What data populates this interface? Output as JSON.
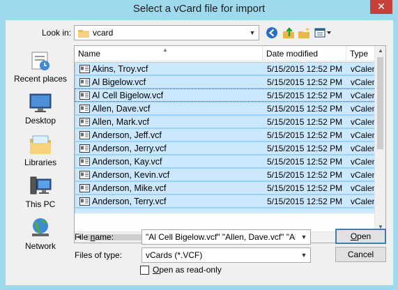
{
  "window": {
    "title": "Select a vCard file for import",
    "close_glyph": "✕"
  },
  "toolbar": {
    "look_in_label": "Look in:",
    "look_in_value": "vcard",
    "icons": [
      "back-icon",
      "up-folder-icon",
      "new-folder-icon",
      "view-menu-icon"
    ]
  },
  "places": [
    {
      "label": "Recent places",
      "icon": "recent-places-icon"
    },
    {
      "label": "Desktop",
      "icon": "desktop-icon"
    },
    {
      "label": "Libraries",
      "icon": "libraries-icon"
    },
    {
      "label": "This PC",
      "icon": "this-pc-icon"
    },
    {
      "label": "Network",
      "icon": "network-icon"
    }
  ],
  "file_list": {
    "columns": [
      "Name",
      "Date modified",
      "Type"
    ],
    "rows": [
      {
        "name": "Akins, Troy.vcf",
        "date": "5/15/2015 12:52 PM",
        "type": "vCalen"
      },
      {
        "name": "Al Bigelow.vcf",
        "date": "5/15/2015 12:52 PM",
        "type": "vCalen"
      },
      {
        "name": "Al Cell Bigelow.vcf",
        "date": "5/15/2015 12:52 PM",
        "type": "vCalen"
      },
      {
        "name": "Allen, Dave.vcf",
        "date": "5/15/2015 12:52 PM",
        "type": "vCalen"
      },
      {
        "name": "Allen, Mark.vcf",
        "date": "5/15/2015 12:52 PM",
        "type": "vCalen"
      },
      {
        "name": "Anderson, Jeff.vcf",
        "date": "5/15/2015 12:52 PM",
        "type": "vCalen"
      },
      {
        "name": "Anderson, Jerry.vcf",
        "date": "5/15/2015 12:52 PM",
        "type": "vCalen"
      },
      {
        "name": "Anderson, Kay.vcf",
        "date": "5/15/2015 12:52 PM",
        "type": "vCalen"
      },
      {
        "name": "Anderson, Kevin.vcf",
        "date": "5/15/2015 12:52 PM",
        "type": "vCalen"
      },
      {
        "name": "Anderson, Mike.vcf",
        "date": "5/15/2015 12:52 PM",
        "type": "vCalen"
      },
      {
        "name": "Anderson, Terry.vcf",
        "date": "5/15/2015 12:52 PM",
        "type": "vCalen"
      }
    ],
    "selection_color": "#cce8ff"
  },
  "form": {
    "file_name_label_prefix": "File ",
    "file_name_label_key": "n",
    "file_name_label_suffix": "ame:",
    "file_name_value": "\"Al Cell Bigelow.vcf\" \"Allen, Dave.vcf\" \"Allen, I",
    "files_of_type_label": "Files of type:",
    "files_of_type_value": "vCards (*.VCF)",
    "readonly_label_key": "O",
    "readonly_label_suffix": "pen as read-only",
    "readonly_checked": false
  },
  "buttons": {
    "open_key": "O",
    "open_suffix": "pen",
    "cancel": "Cancel"
  }
}
